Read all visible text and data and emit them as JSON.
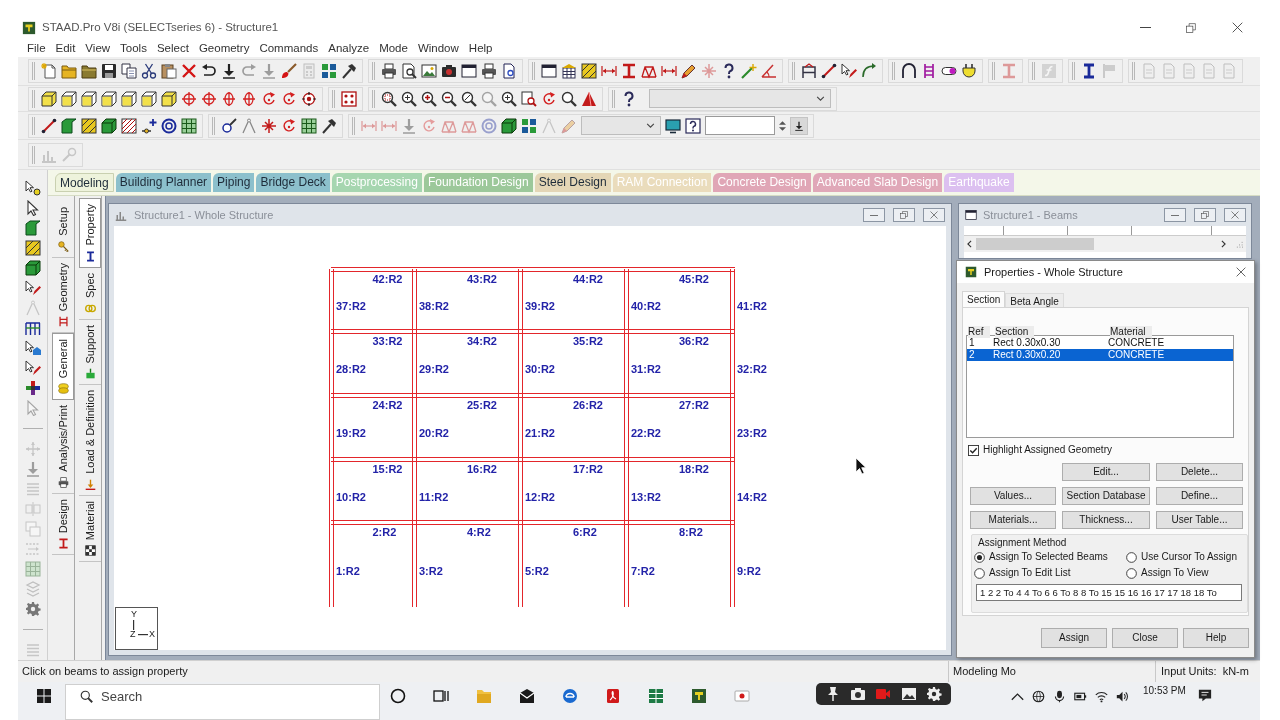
{
  "window": {
    "title": "STAAD.Pro V8i (SELECTseries 6) - Structure1"
  },
  "menu": [
    "File",
    "Edit",
    "View",
    "Tools",
    "Select",
    "Geometry",
    "Commands",
    "Analyze",
    "Mode",
    "Window",
    "Help"
  ],
  "mode_tabs": [
    {
      "label": "Modeling",
      "selected": true,
      "disabled": false,
      "color": "#eef3dc"
    },
    {
      "label": "Building Planner",
      "selected": false,
      "disabled": false,
      "color": "#8cc0cc"
    },
    {
      "label": "Piping",
      "selected": false,
      "disabled": false,
      "color": "#8cc0cc"
    },
    {
      "label": "Bridge Deck",
      "selected": false,
      "disabled": false,
      "color": "#8cc0cc"
    },
    {
      "label": "Postprocessing",
      "selected": false,
      "disabled": true,
      "color": "#a6d6b0"
    },
    {
      "label": "Foundation Design",
      "selected": false,
      "disabled": true,
      "color": "#9cc89a"
    },
    {
      "label": "Steel Design",
      "selected": false,
      "disabled": false,
      "color": "#e4d6b6"
    },
    {
      "label": "RAM Connection",
      "selected": false,
      "disabled": true,
      "color": "#eadcbc"
    },
    {
      "label": "Concrete Design",
      "selected": false,
      "disabled": true,
      "color": "#e0a6b6"
    },
    {
      "label": "Advanced Slab Design",
      "selected": false,
      "disabled": true,
      "color": "#e0a8b8"
    },
    {
      "label": "Earthquake",
      "selected": false,
      "disabled": true,
      "color": "#dcc0f0"
    }
  ],
  "page_tabs": [
    {
      "label": "Setup",
      "selected": false
    },
    {
      "label": "Geometry",
      "selected": false
    },
    {
      "label": "General",
      "selected": true
    },
    {
      "label": "Analysis/Print",
      "selected": false
    },
    {
      "label": "Design",
      "selected": false
    }
  ],
  "sub_tabs": [
    {
      "label": "Property",
      "selected": true
    },
    {
      "label": "Spec",
      "selected": false
    },
    {
      "label": "Support",
      "selected": false
    },
    {
      "label": "Load & Definition",
      "selected": false
    },
    {
      "label": "Material",
      "selected": false
    }
  ],
  "structure_window": {
    "title": "Structure1 - Whole Structure",
    "levels": [
      {
        "beams": [
          "42:R2",
          "43:R2",
          "44:R2",
          "45:R2"
        ],
        "columns": [
          "37:R2",
          "38:R2",
          "39:R2",
          "40:R2",
          "41:R2"
        ]
      },
      {
        "beams": [
          "33:R2",
          "34:R2",
          "35:R2",
          "36:R2"
        ],
        "columns": [
          "28:R2",
          "29:R2",
          "30:R2",
          "31:R2",
          "32:R2"
        ]
      },
      {
        "beams": [
          "24:R2",
          "25:R2",
          "26:R2",
          "27:R2"
        ],
        "columns": [
          "19:R2",
          "20:R2",
          "21:R2",
          "22:R2",
          "23:R2"
        ]
      },
      {
        "beams": [
          "15:R2",
          "16:R2",
          "17:R2",
          "18:R2"
        ],
        "columns": [
          "10:R2",
          "11:R2",
          "12:R2",
          "13:R2",
          "14:R2"
        ]
      },
      {
        "beams": [
          "2:R2",
          "4:R2",
          "6:R2",
          "8:R2"
        ],
        "columns": [
          "1:R2",
          "3:R2",
          "5:R2",
          "7:R2",
          "9:R2"
        ]
      }
    ],
    "axes": {
      "vertical": "Y",
      "depth": "Z",
      "horizontal": "X"
    }
  },
  "beams_window": {
    "title": "Structure1 - Beams"
  },
  "properties_dialog": {
    "title": "Properties - Whole Structure",
    "tabs": [
      {
        "label": "Section",
        "selected": true
      },
      {
        "label": "Beta Angle",
        "selected": false
      }
    ],
    "columns": [
      "Ref",
      "Section",
      "Material"
    ],
    "rows": [
      {
        "ref": "1",
        "section": "Rect 0.30x0.30",
        "material": "CONCRETE",
        "selected": false
      },
      {
        "ref": "2",
        "section": "Rect 0.30x0.20",
        "material": "CONCRETE",
        "selected": true
      }
    ],
    "highlight": {
      "label": "Highlight Assigned Geometry",
      "checked": true
    },
    "buttons": [
      "Edit...",
      "Delete...",
      "Values...",
      "Section Database",
      "Define...",
      "Materials...",
      "Thickness...",
      "User Table..."
    ],
    "assignment": {
      "title": "Assignment Method",
      "options": [
        {
          "label": "Assign To Selected Beams",
          "selected": true
        },
        {
          "label": "Use Cursor To Assign",
          "selected": false
        },
        {
          "label": "Assign To Edit List",
          "selected": false
        },
        {
          "label": "Assign To View",
          "selected": false
        }
      ],
      "list": "1 2 2 To 4 4 To 6 6 To 8 8 To 15 15 16 16 17 17 18 18 To"
    },
    "footer_buttons": [
      "Assign",
      "Close",
      "Help"
    ]
  },
  "status_bar": {
    "message": "Click on beams to assign property",
    "mode": "Modeling Mo",
    "units_label": "Input Units:",
    "units": "kN-m"
  },
  "taskbar": {
    "search_placeholder": "Search",
    "time": "10:53 PM"
  }
}
